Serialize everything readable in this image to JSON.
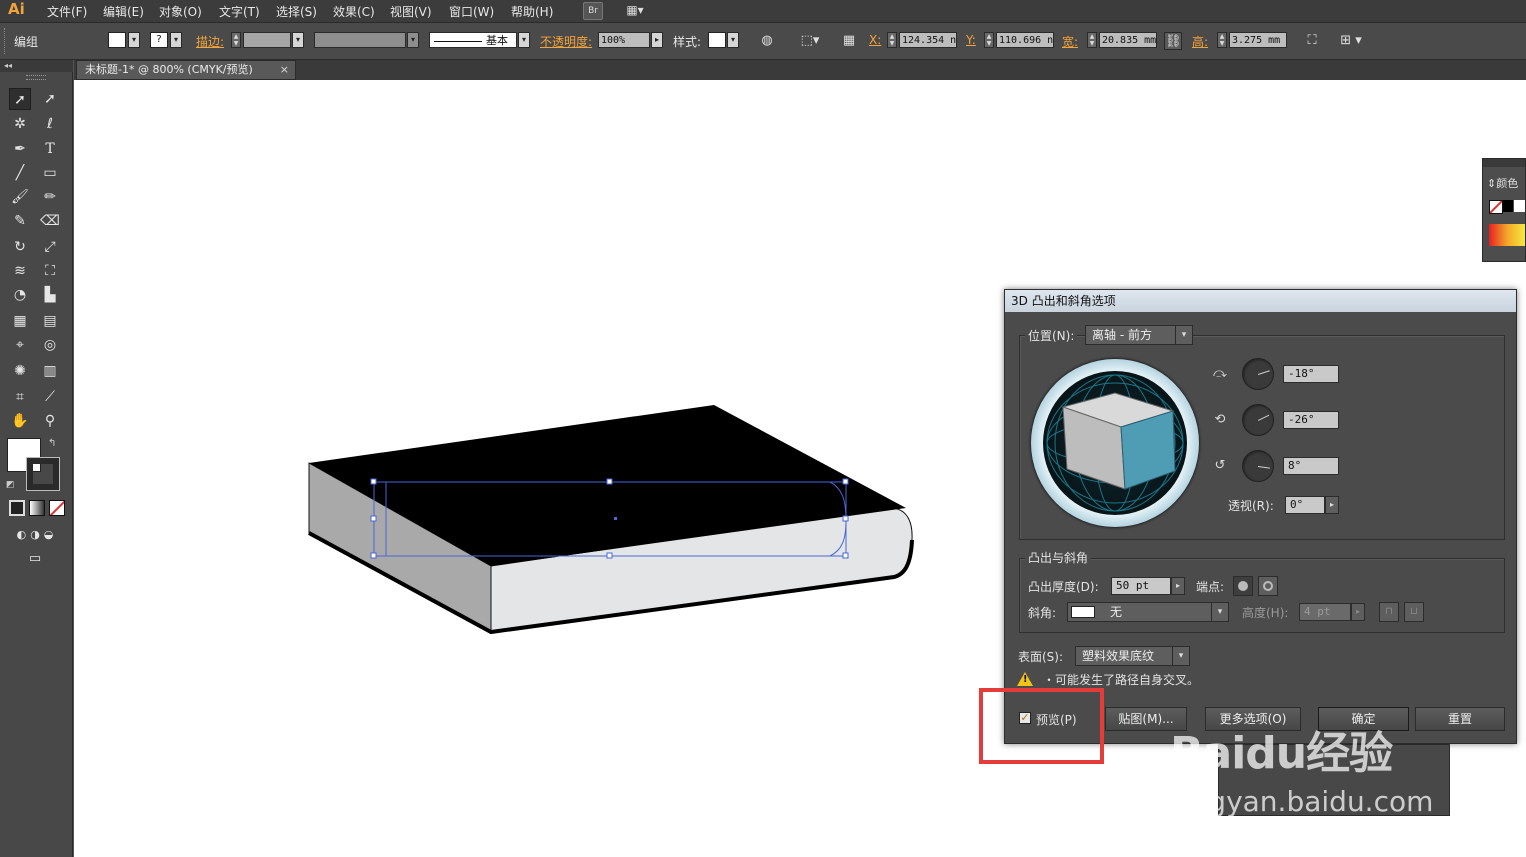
{
  "app": {
    "logo": "Ai"
  },
  "menu": [
    "文件(F)",
    "编辑(E)",
    "对象(O)",
    "文字(T)",
    "选择(S)",
    "效果(C)",
    "视图(V)",
    "窗口(W)",
    "帮助(H)"
  ],
  "menu_extra": {
    "bridge": "Br"
  },
  "control_bar": {
    "selection_label": "编组",
    "stroke_label": "描边:",
    "stroke_style": "基本",
    "opacity_label": "不透明度:",
    "opacity_value": "100%",
    "style_label": "样式:",
    "x_label": "X:",
    "x_value": "124.354 n",
    "y_label": "Y:",
    "y_value": "110.696 n",
    "w_label": "宽:",
    "w_value": "20.835 mm",
    "h_label": "高:",
    "h_value": "3.275 mm"
  },
  "document_tab": {
    "title": "未标题-1* @ 800% (CMYK/预览)",
    "close": "×"
  },
  "color_panel": {
    "title": "颜色"
  },
  "dialog": {
    "title": "3D 凸出和斜角选项",
    "position_label": "位置(N):",
    "position_value": "离轴 - 前方",
    "rot_x": "-18°",
    "rot_y": "-26°",
    "rot_z": "8°",
    "perspective_label": "透视(R):",
    "perspective_value": "0°",
    "extrude_group_label": "凸出与斜角",
    "extrude_depth_label": "凸出厚度(D):",
    "extrude_depth_value": "50 pt",
    "cap_label": "端点:",
    "bevel_label": "斜角:",
    "bevel_value": "无",
    "height_label": "高度(H):",
    "height_value": "4 pt",
    "surface_label": "表面(S):",
    "surface_value": "塑料效果底纹",
    "warning_text": "・可能发生了路径自身交叉。",
    "preview_label": "预览(P)",
    "preview_checked": true,
    "map_button": "贴图(M)...",
    "more_button": "更多选项(O)",
    "ok_button": "确定",
    "reset_button": "重置"
  },
  "watermark": {
    "brand": "Baidu经验",
    "url": "jingyan.baidu.com"
  },
  "colors": {
    "accent": "#f3a43b",
    "selection": "#3b5bd6",
    "highlight": "#e43b3b",
    "cube_front": "#4f9db5"
  }
}
